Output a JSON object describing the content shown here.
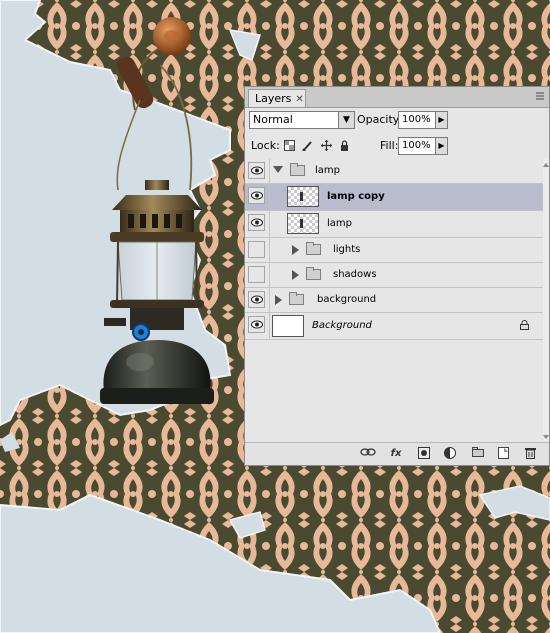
{
  "panel": {
    "tab_label": "Layers",
    "tab_close": "✕",
    "blend_mode": "Normal",
    "opacity_label": "Opacity:",
    "opacity_value": "100%",
    "lock_label": "Lock:",
    "fill_label": "Fill:",
    "fill_value": "100%"
  },
  "layers": [
    {
      "name": "lamp",
      "kind": "group",
      "expanded": true,
      "visible": true,
      "indent": 0
    },
    {
      "name": "lamp copy",
      "kind": "pixel",
      "visible": true,
      "selected": true,
      "indent": 1
    },
    {
      "name": "lamp",
      "kind": "pixel",
      "visible": true,
      "indent": 1
    },
    {
      "name": "lights",
      "kind": "group",
      "expanded": false,
      "visible": false,
      "indent": 1
    },
    {
      "name": "shadows",
      "kind": "group",
      "expanded": false,
      "visible": false,
      "indent": 1
    },
    {
      "name": "background",
      "kind": "group",
      "expanded": false,
      "visible": true,
      "indent": 0
    },
    {
      "name": "Background",
      "kind": "background",
      "visible": true,
      "locked": true,
      "indent": 0
    }
  ],
  "bottom_icons": [
    "link-icon",
    "fx-icon",
    "mask-icon",
    "adjustment-icon",
    "new-group-icon",
    "new-layer-icon",
    "trash-icon"
  ],
  "bottom_labels": {
    "fx": "fx"
  },
  "colors": {
    "wallpaper_dark": "#4a4a30",
    "wallpaper_light": "#e8b998",
    "plaster": "#d3dde4",
    "panel_bg": "#e6e6e6",
    "selected_row": "#b8bccc"
  }
}
